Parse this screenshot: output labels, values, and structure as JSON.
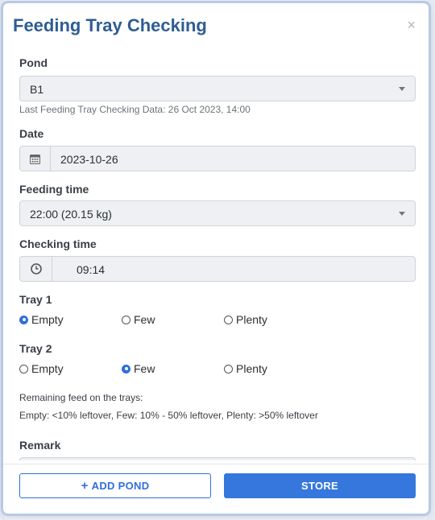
{
  "modal": {
    "title": "Feeding Tray Checking",
    "close_symbol": "×"
  },
  "pond": {
    "label": "Pond",
    "value": "B1",
    "last_check": "Last Feeding Tray Checking Data: 26 Oct 2023, 14:00"
  },
  "date": {
    "label": "Date",
    "icon": "calendar-icon",
    "value": "2023-10-26"
  },
  "feeding_time": {
    "label": "Feeding time",
    "value": "22:00 (20.15 kg)"
  },
  "checking_time": {
    "label": "Checking time",
    "icon": "clock-icon",
    "value": "09:14"
  },
  "tray1": {
    "label": "Tray 1",
    "options": [
      "Empty",
      "Few",
      "Plenty"
    ],
    "selected": "Empty"
  },
  "tray2": {
    "label": "Tray 2",
    "options": [
      "Empty",
      "Few",
      "Plenty"
    ],
    "selected": "Few"
  },
  "notes": {
    "line1": "Remaining feed on the trays:",
    "line2": "Empty: <10% leftover, Few: 10% - 50% leftover, Plenty: >50% leftover"
  },
  "remark": {
    "label": "Remark"
  },
  "footer": {
    "add_pond_label": "ADD POND",
    "store_label": "STORE"
  },
  "colors": {
    "title": "#2f5d92",
    "primary": "#3577dd"
  }
}
